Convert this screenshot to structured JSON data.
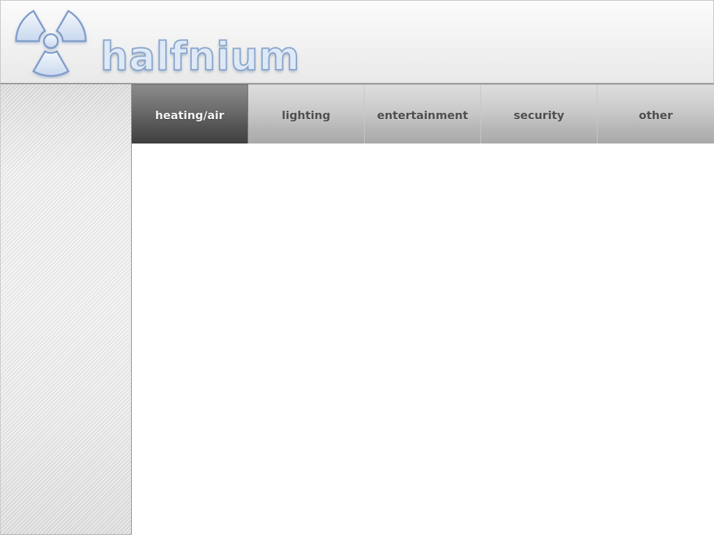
{
  "header": {
    "app_name": "halfnium",
    "logo_icon": "radiation-trefoil-icon",
    "logo_colors": {
      "fill": "#dbe6f5",
      "stroke": "#7f9ccb"
    }
  },
  "tabs": [
    {
      "id": "heating-air",
      "label": "heating/air",
      "active": true
    },
    {
      "id": "lighting",
      "label": "lighting",
      "active": false
    },
    {
      "id": "entertainment",
      "label": "entertainment",
      "active": false
    },
    {
      "id": "security",
      "label": "security",
      "active": false
    },
    {
      "id": "other",
      "label": "other",
      "active": false
    }
  ],
  "colors": {
    "active_tab": "#4a4a4a",
    "inactive_tab": "#bdbdbd",
    "active_tab_text": "#f2f2f2",
    "inactive_tab_text": "#4f4f4f"
  }
}
